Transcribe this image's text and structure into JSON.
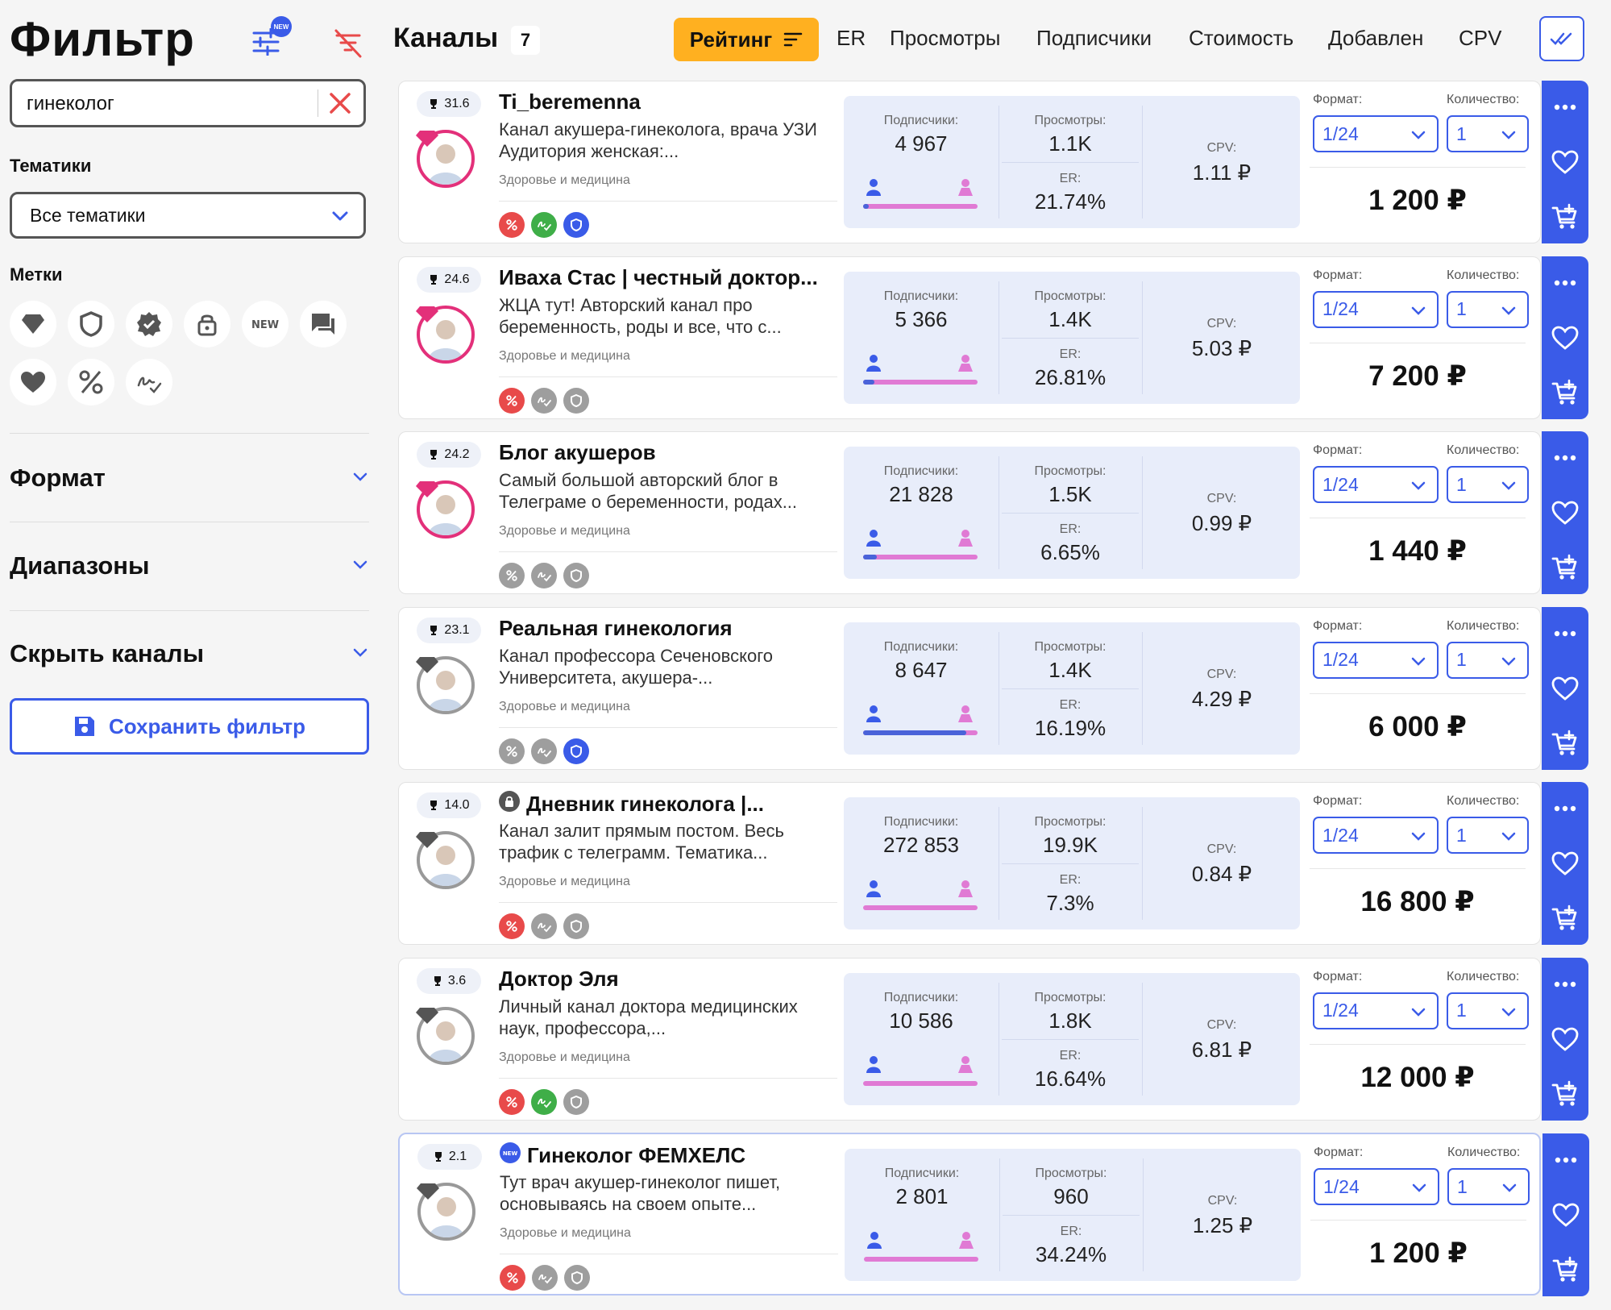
{
  "filter": {
    "title": "Фильтр",
    "search_value": "гинеколог",
    "topics_label": "Тематики",
    "topics_value": "Все тематики",
    "marks_label": "Метки",
    "format_label": "Формат",
    "ranges_label": "Диапазоны",
    "hide_label": "Скрыть каналы",
    "save_label": "Сохранить фильтр",
    "new_badge": "NEW"
  },
  "header": {
    "title": "Каналы",
    "count": "7",
    "sort_active": "Рейтинг",
    "sort_links": [
      "ER",
      "Просмотры",
      "Подписчики",
      "Стоимость",
      "Добавлен",
      "CPV"
    ]
  },
  "labels": {
    "subs": "Подписчики:",
    "views": "Просмотры:",
    "er": "ER:",
    "cpv": "CPV:",
    "format": "Формат:",
    "qty": "Количество:"
  },
  "channels": [
    {
      "rating": "31.6",
      "name": "Ti_beremenna",
      "desc": "Канал акушера-гинеколога, врача УЗИ Аудитория женская:...",
      "topic": "Здоровье и медицина",
      "subs": "4 967",
      "views": "1.1K",
      "er": "21.74%",
      "cpv": "1.11 ₽",
      "format": "1/24",
      "qty": "1",
      "price": "1 200 ₽",
      "male_share": 0.05,
      "marks": [
        "red",
        "green",
        "blue"
      ]
    },
    {
      "rating": "24.6",
      "name": "Иваха Стас | честный доктор...",
      "desc": "ЖЦА тут! Авторский канал про беременность, роды и все, что с...",
      "topic": "Здоровье и медицина",
      "subs": "5 366",
      "views": "1.4K",
      "er": "26.81%",
      "cpv": "5.03 ₽",
      "format": "1/24",
      "qty": "1",
      "price": "7 200 ₽",
      "male_share": 0.1,
      "marks": [
        "red",
        "gray",
        "gray"
      ]
    },
    {
      "rating": "24.2",
      "name": "Блог акушеров",
      "desc": "Самый большой авторский блог в Телеграме о беременности, родах...",
      "topic": "Здоровье и медицина",
      "subs": "21 828",
      "views": "1.5K",
      "er": "6.65%",
      "cpv": "0.99 ₽",
      "format": "1/24",
      "qty": "1",
      "price": "1 440 ₽",
      "male_share": 0.12,
      "marks": [
        "gray",
        "gray",
        "gray"
      ]
    },
    {
      "rating": "23.1",
      "name": "Реальная гинекология",
      "desc": "Канал профессора Сеченовского Университета, акушера-...",
      "topic": "Здоровье и медицина",
      "subs": "8 647",
      "views": "1.4K",
      "er": "16.19%",
      "cpv": "4.29 ₽",
      "format": "1/24",
      "qty": "1",
      "price": "6 000 ₽",
      "male_share": 0.9,
      "marks": [
        "gray",
        "gray",
        "blue"
      ]
    },
    {
      "rating": "14.0",
      "name": "Дневник гинеколога |...",
      "desc": "Канал залит прямым постом. Весь трафик с телеграмм. Тематика...",
      "topic": "Здоровье и медицина",
      "subs": "272 853",
      "views": "19.9K",
      "er": "7.3%",
      "cpv": "0.84 ₽",
      "format": "1/24",
      "qty": "1",
      "price": "16 800 ₽",
      "male_share": 0.0,
      "marks": [
        "red",
        "gray",
        "gray"
      ],
      "prefix": "lock"
    },
    {
      "rating": "3.6",
      "name": "Доктор Эля",
      "desc": "Личный канал доктора медицинских наук, профессора,...",
      "topic": "Здоровье и медицина",
      "subs": "10 586",
      "views": "1.8K",
      "er": "16.64%",
      "cpv": "6.81 ₽",
      "format": "1/24",
      "qty": "1",
      "price": "12 000 ₽",
      "male_share": 0.0,
      "marks": [
        "red",
        "green",
        "gray"
      ]
    },
    {
      "rating": "2.1",
      "name": "Гинеколог ФЕМХЕЛС",
      "desc": "Тут врач акушер-гинеколог пишет, основываясь на своем опыте...",
      "topic": "Здоровье и медицина",
      "subs": "2 801",
      "views": "960",
      "er": "34.24%",
      "cpv": "1.25 ₽",
      "format": "1/24",
      "qty": "1",
      "price": "1 200 ₽",
      "male_share": 0.0,
      "marks": [
        "red",
        "gray",
        "gray"
      ],
      "prefix": "new"
    }
  ],
  "colors": {
    "accent": "#3a5be8",
    "sort_active": "#ffb020",
    "male": "#4a63d9",
    "female": "#e07ad4"
  }
}
